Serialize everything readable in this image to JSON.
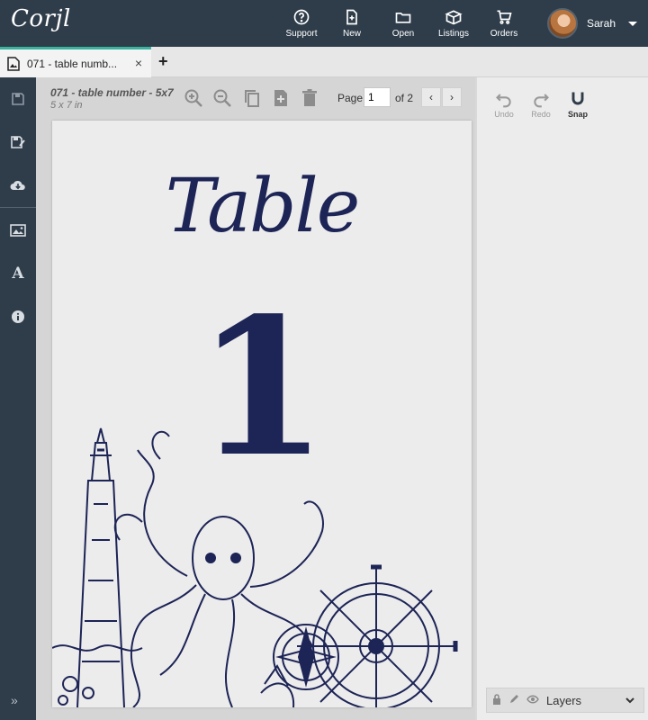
{
  "app": {
    "logo": "Corjl"
  },
  "topnav": {
    "items": [
      {
        "label": "Support",
        "icon": "question-circle-icon"
      },
      {
        "label": "New",
        "icon": "new-file-icon"
      },
      {
        "label": "Open",
        "icon": "folder-icon"
      },
      {
        "label": "Listings",
        "icon": "box-icon"
      },
      {
        "label": "Orders",
        "icon": "cart-icon"
      }
    ],
    "user": {
      "name": "Sarah"
    }
  },
  "tabs": [
    {
      "label": "071 - table numb...",
      "close": "×"
    }
  ],
  "tab_add": "+",
  "document": {
    "title": "071 - table number - 5x7",
    "size": "5 x 7 in",
    "page_label": "Page",
    "page_value": "1",
    "page_of": "of 2"
  },
  "canvas": {
    "word": "Table",
    "number": "1"
  },
  "rightpanel": {
    "undo": "Undo",
    "redo": "Redo",
    "snap": "Snap",
    "layers": "Layers"
  },
  "colors": {
    "topbar": "#2f3d4b",
    "accent": "#3bb3a0",
    "navy_ink": "#1d2456"
  }
}
